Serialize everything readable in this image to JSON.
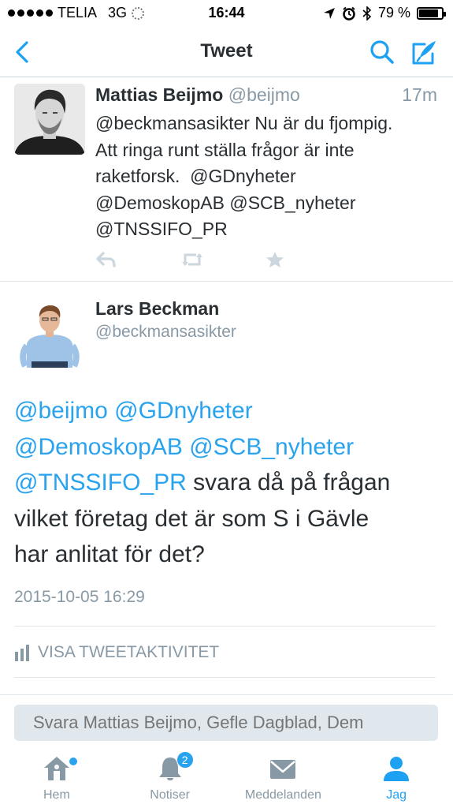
{
  "status_bar": {
    "carrier": "TELIA",
    "network": "3G",
    "time": "16:44",
    "battery": "79 %",
    "battery_level": 0.79
  },
  "nav": {
    "title": "Tweet"
  },
  "parent_tweet": {
    "name": "Mattias Beijmo",
    "handle": "@beijmo",
    "time": "17m",
    "text_lines": [
      "@beckmansasikter Nu är du fjompig.",
      "Att ringa runt ställa frågor är inte",
      "raketforsk.  @GDnyheter",
      "@DemoskopAB @SCB_nyheter",
      "@TNSSIFO_PR"
    ],
    "actions": [
      "reply-icon",
      "retweet-icon",
      "favorite-icon"
    ]
  },
  "detail_tweet": {
    "name": "Lars Beckman",
    "handle": "@beckmansasikter",
    "mentions_line1": "@beijmo @GDnyheter",
    "mentions_line2": "@DemoskopAB @SCB_nyheter",
    "mention_line3": "@TNSSIFO_PR",
    "text_line3_rest": " svara då på frågan",
    "text_line4": "vilket företag det är som S i Gävle",
    "text_line5": "har anlitat för det?",
    "date": "2015-10-05 16:29",
    "activity_label": "VISA TWEETAKTIVITET"
  },
  "reply": {
    "placeholder": "Svara Mattias Beijmo, Gefle Dagblad, Dem"
  },
  "tabs": [
    {
      "label": "Hem",
      "icon": "home-icon"
    },
    {
      "label": "Notiser",
      "icon": "bell-icon",
      "badge": "2"
    },
    {
      "label": "Meddelanden",
      "icon": "envelope-icon"
    },
    {
      "label": "Jag",
      "icon": "person-icon",
      "active": true
    }
  ],
  "colors": {
    "accent": "#1da1f2",
    "mention": "#2aa3ef",
    "muted": "#8899a6",
    "text": "#292f33",
    "divider": "#e1e8ed"
  }
}
